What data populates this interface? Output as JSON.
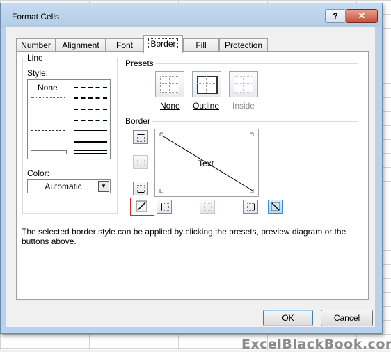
{
  "window": {
    "title": "Format Cells",
    "help_glyph": "?",
    "close_glyph": "✕"
  },
  "tabs": [
    {
      "label": "Number"
    },
    {
      "label": "Alignment"
    },
    {
      "label": "Font"
    },
    {
      "label": "Border",
      "active": true
    },
    {
      "label": "Fill"
    },
    {
      "label": "Protection"
    }
  ],
  "line_group": {
    "title": "Line",
    "style_label": "Style:",
    "none_label": "None",
    "color_label": "Color:",
    "color_value": "Automatic"
  },
  "presets": {
    "title": "Presets",
    "items": [
      {
        "label": "None",
        "underline": "N",
        "enabled": true
      },
      {
        "label": "Outline",
        "underline": "O",
        "enabled": true
      },
      {
        "label": "Inside",
        "enabled": false
      }
    ]
  },
  "border_group": {
    "title": "Border",
    "preview_text": "Text"
  },
  "note": "The selected border style can be applied by clicking the presets, preview diagram or the buttons above.",
  "buttons": {
    "ok": "OK",
    "cancel": "Cancel"
  },
  "watermark": "ExcelBlackBook.com",
  "colors": {
    "titlebar": "#b9d1ea",
    "highlight": "#d9262a",
    "diag_active": "#3c8fd6"
  }
}
